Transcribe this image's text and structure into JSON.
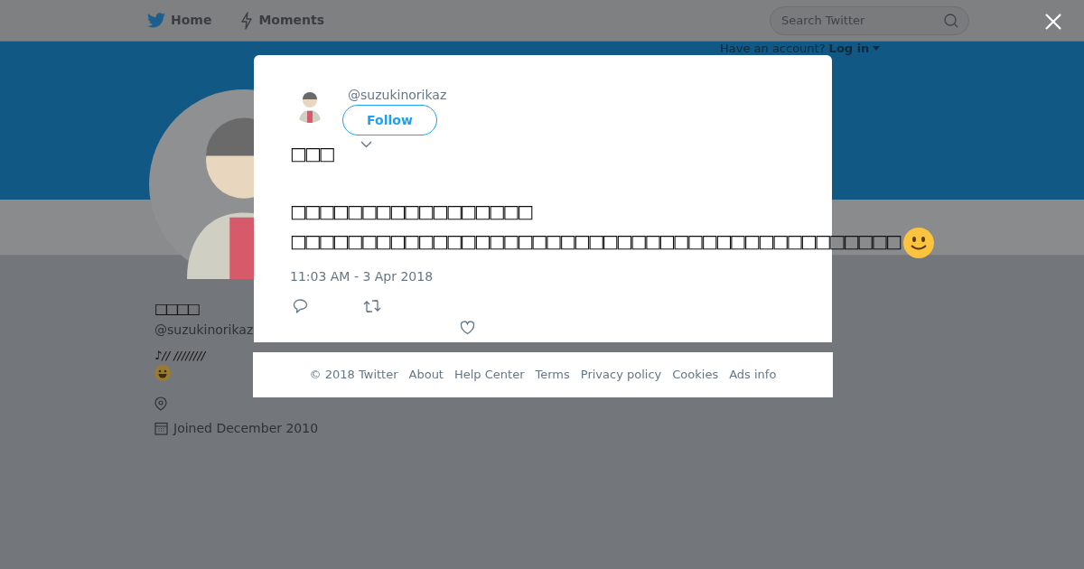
{
  "nav": {
    "items": [
      {
        "kind": "bird",
        "label": "Home"
      },
      {
        "kind": "bolt",
        "label": "Moments"
      }
    ],
    "search": {
      "placeholder": "Search Twitter"
    },
    "login_prompt": {
      "question": "Have an account?",
      "link": "Log in"
    }
  },
  "profile": {
    "name": "□□□□",
    "handle": "@suzukinorikaz",
    "bio": "♪// ////////",
    "joined": "Joined December 2010"
  },
  "tweet": {
    "handle": "@suzukinorikaz",
    "follow": "Follow",
    "name": "□□□",
    "text": "□□□□□□□□□□□□□□□□□\n□□□□□□□□□□□□□□□□□□□□□□□□□□□□□□□□□□□□□□□□□□□",
    "time": "11:03 AM - 3 Apr 2018"
  },
  "footer": [
    "© 2018 Twitter",
    "About",
    "Help Center",
    "Terms",
    "Privacy policy",
    "Cookies",
    "Ads info"
  ]
}
